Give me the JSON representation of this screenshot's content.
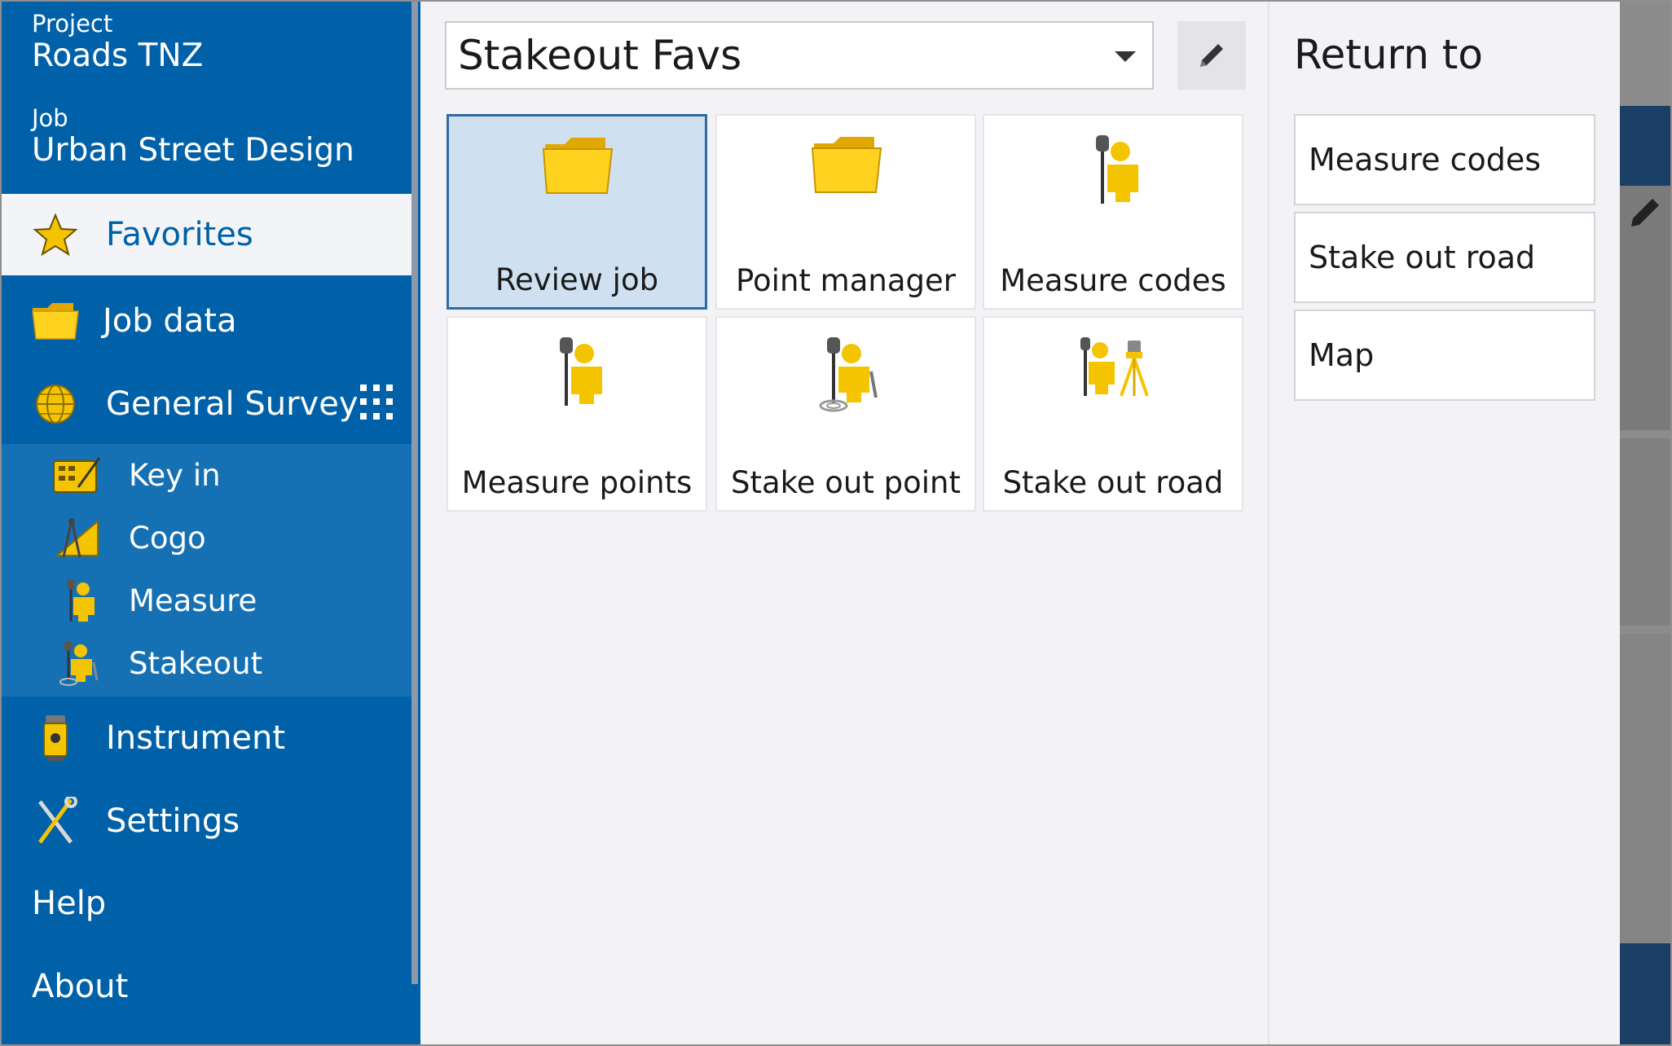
{
  "sidebar": {
    "project_label": "Project",
    "project_value": "Roads TNZ",
    "job_label": "Job",
    "job_value": "Urban Street Design",
    "items": {
      "favorites": "Favorites",
      "job_data": "Job data",
      "general_survey": "General Survey",
      "key_in": "Key in",
      "cogo": "Cogo",
      "measure": "Measure",
      "stakeout": "Stakeout",
      "instrument": "Instrument",
      "settings": "Settings",
      "help": "Help",
      "about": "About"
    }
  },
  "favorites_panel": {
    "list_name": "Stakeout Favs",
    "tiles": [
      {
        "label": "Review job",
        "icon": "folder-icon",
        "selected": true
      },
      {
        "label": "Point manager",
        "icon": "folder-icon",
        "selected": false
      },
      {
        "label": "Measure codes",
        "icon": "surveyor-measure-icon",
        "selected": false
      },
      {
        "label": "Measure points",
        "icon": "surveyor-measure-icon",
        "selected": false
      },
      {
        "label": "Stake out point",
        "icon": "surveyor-stakeout-icon",
        "selected": false
      },
      {
        "label": "Stake out road",
        "icon": "surveyor-road-icon",
        "selected": false
      }
    ]
  },
  "return_panel": {
    "title": "Return to",
    "items": [
      "Measure codes",
      "Stake out road",
      "Map"
    ]
  },
  "colors": {
    "sidebar_bg": "#0061a8",
    "sidebar_sub_bg": "#1670b4",
    "selected_tile_bg": "#cfe1f0",
    "icon_yellow": "#f5c400"
  }
}
